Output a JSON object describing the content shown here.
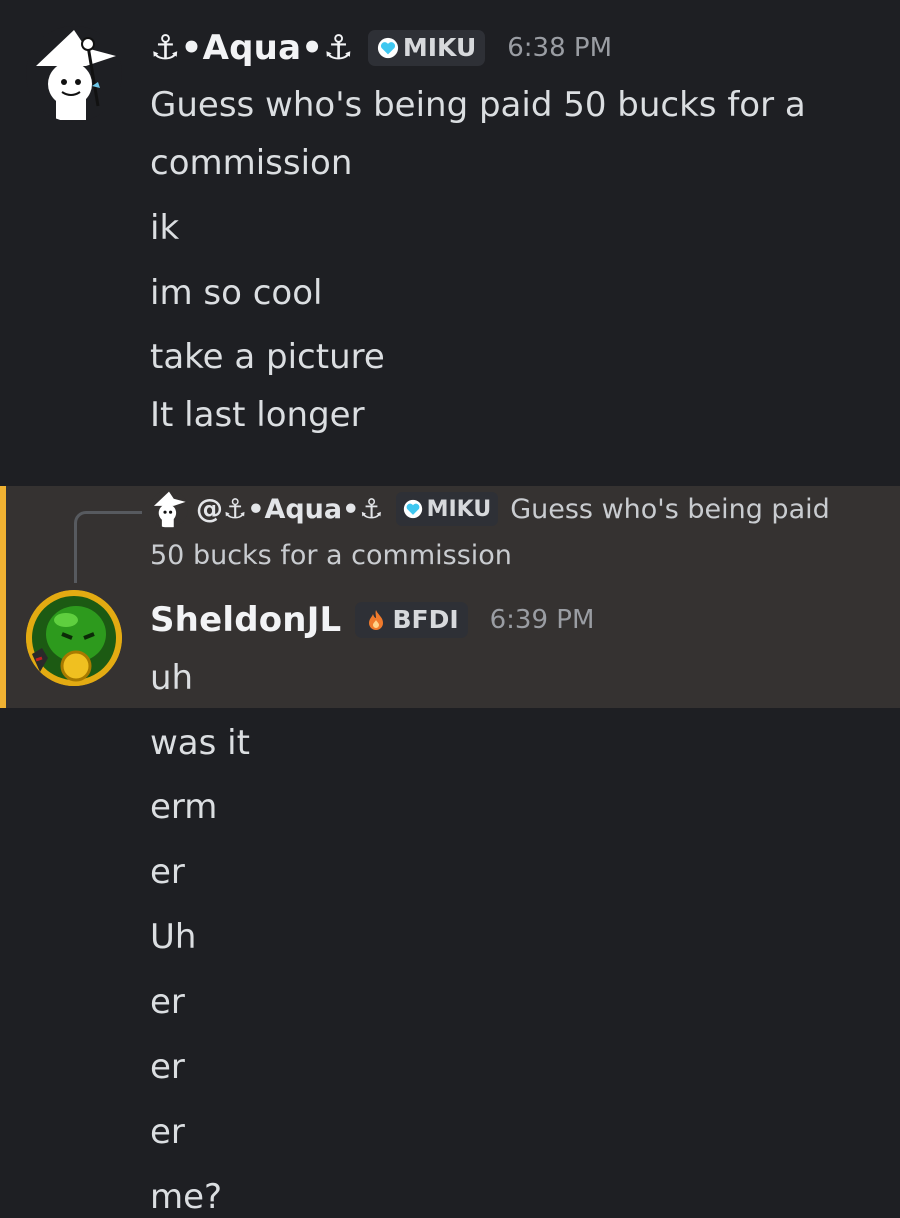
{
  "messages": [
    {
      "author": "⚓•Aqua•⚓",
      "tag": {
        "icon": "heart-icon",
        "label": "MIKU",
        "color": "#3fc7f0"
      },
      "timestamp": "6:38 PM",
      "lines": [
        "Guess who's being paid 50 bucks for a",
        "commission",
        "ik",
        "im so cool",
        "take a picture",
        "It last longer"
      ]
    },
    {
      "reply": {
        "author": "@⚓•Aqua•⚓",
        "tag": {
          "icon": "heart-icon",
          "label": "MIKU"
        },
        "preview_line1": "Guess who's being paid",
        "preview_line2": "50 bucks for a commission"
      },
      "author": "SheldonJL",
      "tag": {
        "icon": "flame-icon",
        "label": "BFDI",
        "color": "#f07a2c"
      },
      "timestamp": "6:39 PM",
      "lines": [
        "uh",
        "was it",
        "erm",
        "er",
        "Uh",
        "er",
        "er",
        "er",
        "me?"
      ]
    }
  ],
  "colors": {
    "background": "#1e1f23",
    "highlight": "#353231",
    "highlight_bar": "#f0b232"
  }
}
